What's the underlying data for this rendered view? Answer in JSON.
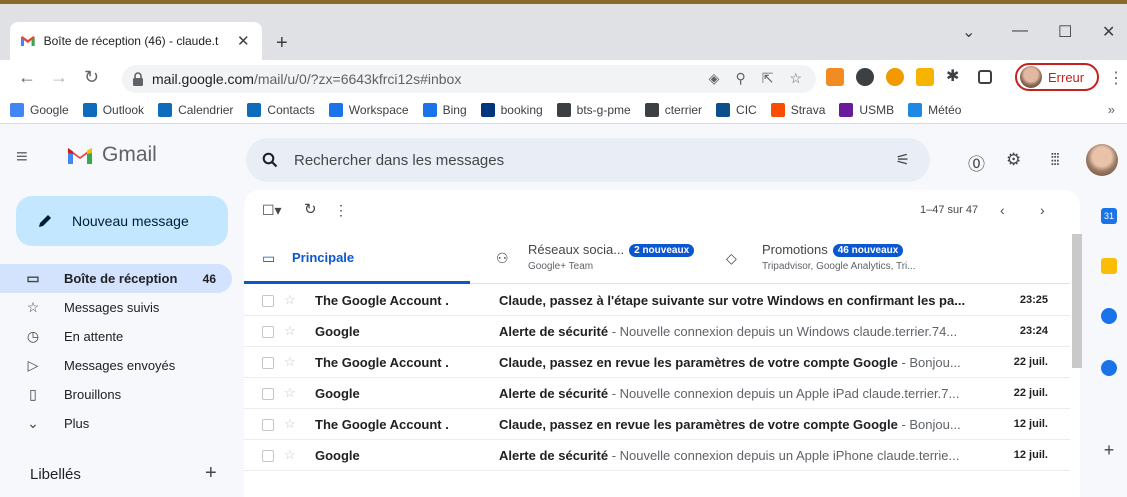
{
  "colors": {
    "accent_blue": "#0b57d0",
    "compose_bg": "#c2e7ff",
    "nav_active_bg": "#d3e3fd",
    "profile_error_red": "#c5221f"
  },
  "browser": {
    "tab_title": "Boîte de réception (46) - claude.t",
    "tab_close": "✕",
    "new_tab": "+",
    "url_host": "mail.google.com",
    "url_path": "/mail/u/0/?zx=6643kfrci12s#inbox",
    "profile_label": "Erreur",
    "bookmarks": [
      {
        "label": "Google",
        "icon": "google-icon",
        "color": "#4285f4"
      },
      {
        "label": "Outlook",
        "icon": "outlook-icon",
        "color": "#0f6cbd"
      },
      {
        "label": "Calendrier",
        "icon": "outlook-icon",
        "color": "#0f6cbd"
      },
      {
        "label": "Contacts",
        "icon": "outlook-icon",
        "color": "#0f6cbd"
      },
      {
        "label": "Workspace",
        "icon": "k-icon",
        "color": "#1a73e8"
      },
      {
        "label": "Bing",
        "icon": "bing-icon",
        "color": "#1a73e8"
      },
      {
        "label": "booking",
        "icon": "booking-icon",
        "color": "#003580"
      },
      {
        "label": "bts-g-pme",
        "icon": "globe-icon",
        "color": "#3c4043"
      },
      {
        "label": "cterrier",
        "icon": "globe-icon",
        "color": "#3c4043"
      },
      {
        "label": "CIC",
        "icon": "cic-icon",
        "color": "#0d4f8b"
      },
      {
        "label": "Strava",
        "icon": "strava-icon",
        "color": "#fc4c02"
      },
      {
        "label": "USMB",
        "icon": "usmb-icon",
        "color": "#6a1b9a"
      },
      {
        "label": "Météo",
        "icon": "meteo-icon",
        "color": "#1e88e5"
      }
    ],
    "bookmarks_more": "»"
  },
  "gmail": {
    "brand": "Gmail",
    "search_placeholder": "Rechercher dans les messages",
    "compose_label": "Nouveau message",
    "nav": [
      {
        "label": "Boîte de réception",
        "count": "46",
        "icon": "inbox-icon",
        "glyph": "▭",
        "active": true
      },
      {
        "label": "Messages suivis",
        "count": "",
        "icon": "star-icon",
        "glyph": "☆",
        "active": false
      },
      {
        "label": "En attente",
        "count": "",
        "icon": "clock-icon",
        "glyph": "◷",
        "active": false
      },
      {
        "label": "Messages envoyés",
        "count": "",
        "icon": "send-icon",
        "glyph": "▷",
        "active": false
      },
      {
        "label": "Brouillons",
        "count": "",
        "icon": "draft-icon",
        "glyph": "▯",
        "active": false
      },
      {
        "label": "Plus",
        "count": "",
        "icon": "chevron-down-icon",
        "glyph": "⌄",
        "active": false
      }
    ],
    "labels_title": "Libellés",
    "labels_add": "+",
    "pager": "1–47 sur 47",
    "tabs": {
      "primary": "Principale",
      "social": "Réseaux socia...",
      "social_badge": "2 nouveaux",
      "social_sub": "Google+ Team",
      "promotions": "Promotions",
      "promotions_badge": "46 nouveaux",
      "promotions_sub": "Tripadvisor, Google Analytics, Tri..."
    },
    "emails": [
      {
        "sender": "The Google Account .",
        "subject": "Claude, passez à l'étape suivante sur votre Windows en confirmant les pa...",
        "snippet": "",
        "time": "23:25"
      },
      {
        "sender": "Google",
        "subject": "Alerte de sécurité",
        "snippet": " - Nouvelle connexion depuis un Windows claude.terrier.74...",
        "time": "23:24"
      },
      {
        "sender": "The Google Account .",
        "subject": "Claude, passez en revue les paramètres de votre compte Google",
        "snippet": " - Bonjou...",
        "time": "22 juil."
      },
      {
        "sender": "Google",
        "subject": "Alerte de sécurité",
        "snippet": " - Nouvelle connexion depuis un Apple iPad claude.terrier.7...",
        "time": "22 juil."
      },
      {
        "sender": "The Google Account .",
        "subject": "Claude, passez en revue les paramètres de votre compte Google",
        "snippet": " - Bonjou...",
        "time": "12 juil."
      },
      {
        "sender": "Google",
        "subject": "Alerte de sécurité",
        "snippet": " - Nouvelle connexion depuis un Apple iPhone claude.terrie...",
        "time": "12 juil."
      }
    ]
  }
}
